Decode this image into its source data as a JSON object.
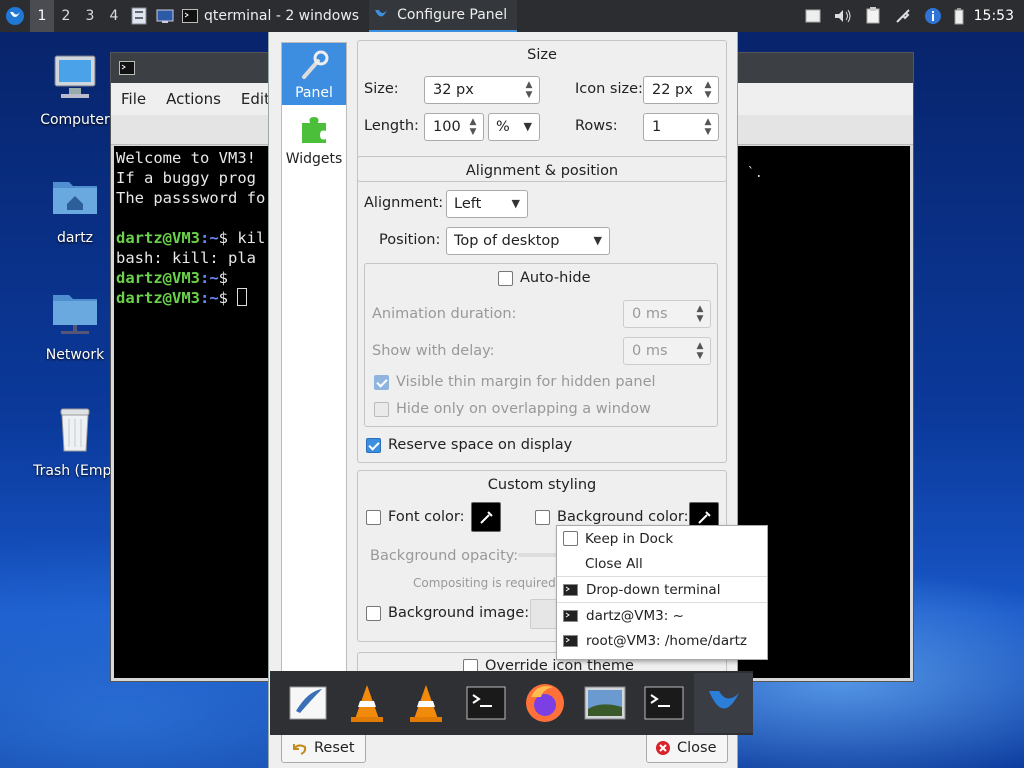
{
  "top_panel": {
    "workspaces": [
      "1",
      "2",
      "3",
      "4"
    ],
    "active_workspace": "1",
    "tasks": [
      {
        "label": "qterminal - 2 windows",
        "active": false
      },
      {
        "label": "Configure Panel",
        "active": true
      }
    ],
    "clock": "15:53",
    "accent_color": "#3d8fe0"
  },
  "desktop_icons": [
    {
      "label": "Computer",
      "icon": "computer-icon"
    },
    {
      "label": "dartz",
      "icon": "home-folder-icon"
    },
    {
      "label": "Network",
      "icon": "network-folder-icon"
    },
    {
      "label": "Trash (Empt",
      "icon": "trash-icon"
    }
  ],
  "terminal": {
    "menu": [
      "File",
      "Actions",
      "Edit"
    ],
    "lines": [
      {
        "text": "Welcome to VM3!"
      },
      {
        "text": "If a buggy prog"
      },
      {
        "text": "The passsword fo"
      },
      {
        "text": ""
      },
      {
        "prompt_user": "dartz@VM3",
        "prompt_path": ":~",
        "prompt_tail": "$ kil"
      },
      {
        "text": "bash: kill: pla"
      },
      {
        "prompt_user": "dartz@VM3",
        "prompt_path": ":~",
        "prompt_tail": "$"
      },
      {
        "prompt_user": "dartz@VM3",
        "prompt_path": ":~",
        "prompt_tail": "$ "
      }
    ],
    "right_fragment": "`."
  },
  "dialog": {
    "title": "Configure Panel",
    "sidebar": [
      {
        "label": "Panel",
        "icon": "wrench-icon",
        "selected": true
      },
      {
        "label": "Widgets",
        "icon": "puzzle-icon",
        "selected": false
      }
    ],
    "size": {
      "title": "Size",
      "size_label": "Size:",
      "size_value": "32 px",
      "icon_size_label": "Icon size:",
      "icon_size_value": "22 px",
      "length_label": "Length:",
      "length_value": "100",
      "length_unit": "%",
      "rows_label": "Rows:",
      "rows_value": "1"
    },
    "alignment": {
      "title": "Alignment & position",
      "alignment_label": "Alignment:",
      "alignment_value": "Left",
      "position_label": "Position:",
      "position_value": "Top of desktop",
      "autohide_label": "Auto-hide",
      "autohide_checked": false,
      "anim_label": "Animation duration:",
      "anim_value": "0 ms",
      "delay_label": "Show with delay:",
      "delay_value": "0 ms",
      "thin_margin_label": "Visible thin margin for hidden panel",
      "thin_margin_checked": true,
      "overlap_label": "Hide only on overlapping a window",
      "overlap_checked": false,
      "reserve_label": "Reserve space on display",
      "reserve_checked": true
    },
    "styling": {
      "title": "Custom styling",
      "font_color_label": "Font color:",
      "bg_color_label": "Background color:",
      "opacity_label": "Background opacity:",
      "compositing_note": "Compositing is required fo",
      "bg_image_label": "Background image:",
      "override_label": "Override icon theme"
    },
    "reset_label": "Reset",
    "close_label": "Close"
  },
  "context_menu": {
    "items": [
      {
        "label": "Keep in Dock",
        "type": "check"
      },
      {
        "label": "Close All",
        "type": "plain"
      },
      {
        "label": "Drop-down terminal",
        "type": "window"
      },
      {
        "label": "dartz@VM3: ~",
        "type": "window"
      },
      {
        "label": "root@VM3: /home/dartz",
        "type": "window"
      }
    ]
  },
  "dock": {
    "items": [
      "text-editor-icon",
      "vlc-icon",
      "vlc-icon",
      "terminal-icon",
      "firefox-icon",
      "image-viewer-icon",
      "terminal-icon",
      "lxqt-icon"
    ]
  }
}
